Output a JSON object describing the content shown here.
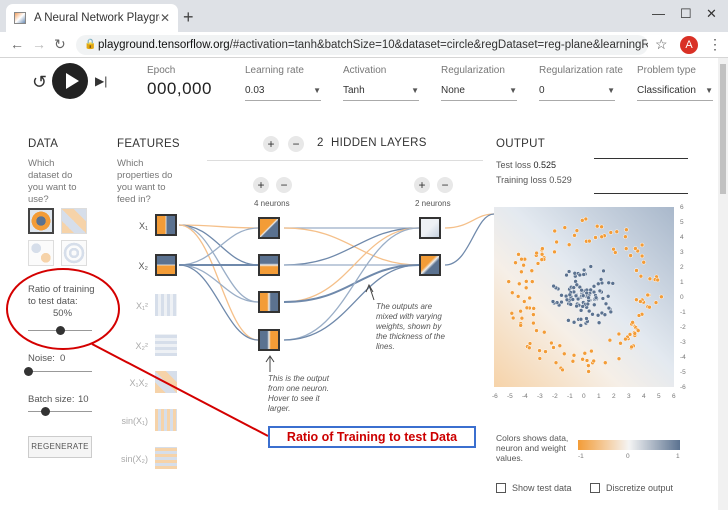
{
  "browser": {
    "tab_title": "A Neural Network Playground",
    "url_host": "playground.tensorflow.org",
    "url_rest": "/#activation=tanh&batchSize=10&dataset=circle&regDataset=reg-plane&learningRate=0.03&re...",
    "avatar_letter": "A"
  },
  "controls": {
    "epoch_label": "Epoch",
    "epoch_value": "000,000",
    "learning_rate_label": "Learning rate",
    "learning_rate_value": "0.03",
    "activation_label": "Activation",
    "activation_value": "Tanh",
    "regularization_label": "Regularization",
    "regularization_value": "None",
    "reg_rate_label": "Regularization rate",
    "reg_rate_value": "0",
    "problem_type_label": "Problem type",
    "problem_type_value": "Classification"
  },
  "data": {
    "header": "DATA",
    "question": "Which dataset do you want to use?",
    "ratio_label": "Ratio of training to test data:",
    "ratio_value": "50%",
    "ratio_fraction": 0.5,
    "noise_label": "Noise:",
    "noise_value": "0",
    "batch_label": "Batch size:",
    "batch_value": "10",
    "regenerate_label": "REGENERATE"
  },
  "features": {
    "header": "FEATURES",
    "question": "Which properties do you want to feed in?",
    "items": [
      {
        "label": "X₁",
        "active": true
      },
      {
        "label": "X₂",
        "active": true
      },
      {
        "label": "X₁²",
        "active": false
      },
      {
        "label": "X₂²",
        "active": false
      },
      {
        "label": "X₁X₂",
        "active": false
      },
      {
        "label": "sin(X₁)",
        "active": false
      },
      {
        "label": "sin(X₂)",
        "active": false
      }
    ]
  },
  "network": {
    "layers_count": "2",
    "layers_label": "HIDDEN LAYERS",
    "layer1_neurons": "4 neurons",
    "layer2_neurons": "2 neurons",
    "note_neuron": "This is the output from one neuron. Hover to see it larger.",
    "note_outputs": "The outputs are mixed with varying weights, shown by the thickness of the lines."
  },
  "output": {
    "header": "OUTPUT",
    "test_loss_label": "Test loss",
    "test_loss_value": "0.525",
    "training_loss_label": "Training loss",
    "training_loss_value": "0.529",
    "axis_ticks": [
      "6",
      "5",
      "4",
      "3",
      "2",
      "1",
      "0",
      "-1",
      "-2",
      "-3",
      "-4",
      "-5",
      "-6"
    ],
    "colors_legend": "Colors shows data, neuron and weight values.",
    "cbar_ticks": [
      "-1",
      "0",
      "1"
    ],
    "show_test_label": "Show test data",
    "discretize_label": "Discretize output"
  },
  "annotation": {
    "text": "Ratio of Training to test Data",
    "color": "#cc0000"
  },
  "colors": {
    "orange": "#f39c37",
    "blue": "#5b7290",
    "annotation_red": "#d40000"
  }
}
